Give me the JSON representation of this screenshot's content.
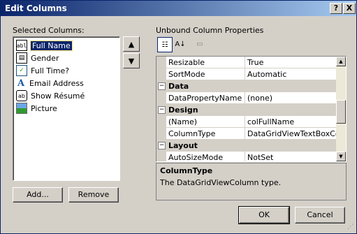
{
  "window": {
    "title": "Edit Columns",
    "help_label": "?",
    "close_label": "X"
  },
  "left": {
    "label": "Selected Columns:",
    "items": [
      {
        "label": "Full Name",
        "icon": "textbox-icon",
        "glyph": "abl"
      },
      {
        "label": "Gender",
        "icon": "combobox-icon",
        "glyph": "▤"
      },
      {
        "label": "Full Time?",
        "icon": "checkbox-icon",
        "glyph": "✓"
      },
      {
        "label": "Email Address",
        "icon": "link-icon",
        "glyph": "A"
      },
      {
        "label": "Show Résumé",
        "icon": "button-icon",
        "glyph": "ab"
      },
      {
        "label": "Picture",
        "icon": "image-icon",
        "glyph": ""
      }
    ],
    "add_label": "Add...",
    "remove_label": "Remove",
    "up_glyph": "▲",
    "down_glyph": "▼"
  },
  "right": {
    "label": "Unbound Column Properties",
    "toolbar": {
      "categorized_glyph": "☷",
      "alphabetical_glyph": "A↓",
      "pages_glyph": "▭"
    },
    "rows": [
      {
        "kind": "prop",
        "name": "Resizable",
        "value": "True"
      },
      {
        "kind": "prop",
        "name": "SortMode",
        "value": "Automatic"
      },
      {
        "kind": "cat",
        "name": "Data",
        "toggle": "−"
      },
      {
        "kind": "prop",
        "name": "DataPropertyName",
        "value": "(none)"
      },
      {
        "kind": "cat",
        "name": "Design",
        "toggle": "−"
      },
      {
        "kind": "prop",
        "name": "(Name)",
        "value": "colFullName"
      },
      {
        "kind": "prop",
        "name": "ColumnType",
        "value": "DataGridViewTextBoxColumn"
      },
      {
        "kind": "cat",
        "name": "Layout",
        "toggle": "−"
      },
      {
        "kind": "prop",
        "name": "AutoSizeMode",
        "value": "NotSet"
      }
    ],
    "desc_title": "ColumnType",
    "desc_text": "The DataGridViewColumn type."
  },
  "footer": {
    "ok_label": "OK",
    "cancel_label": "Cancel"
  }
}
